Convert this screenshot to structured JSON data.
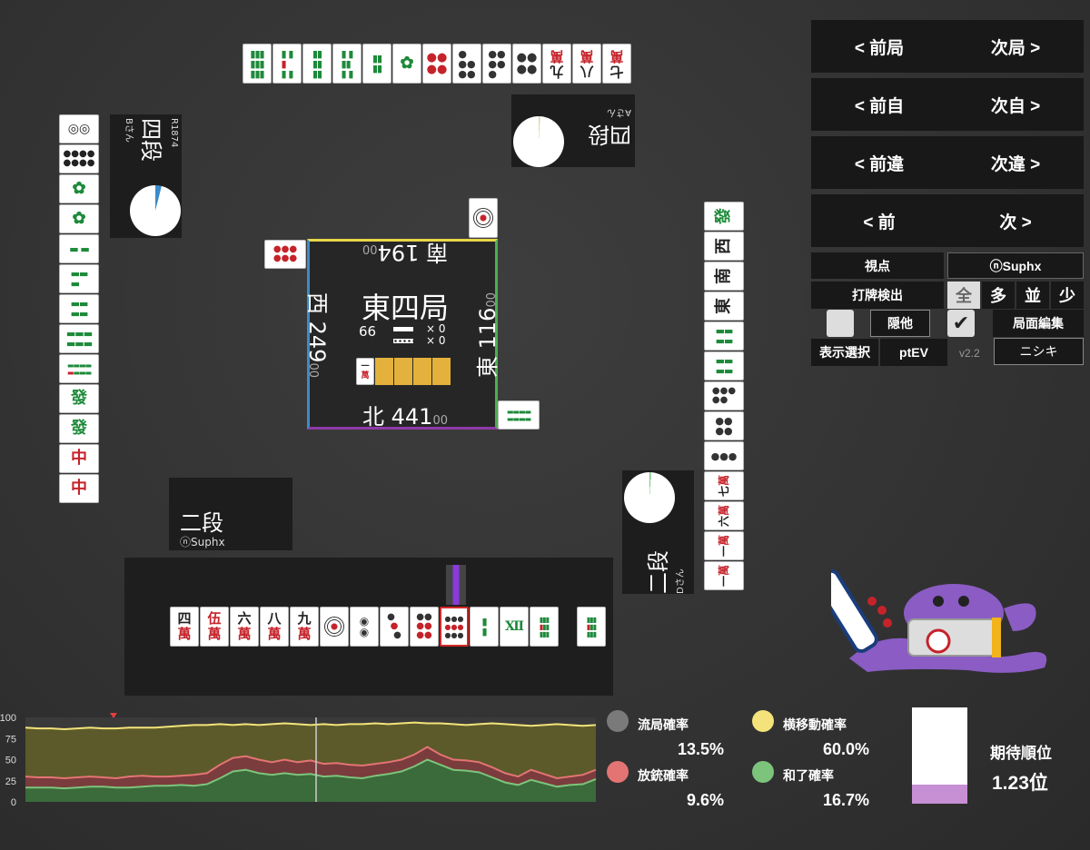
{
  "round": {
    "name": "東四局",
    "honba": "66",
    "riichi": "0",
    "honba_mult": "0"
  },
  "scores": {
    "south": {
      "wind": "南",
      "points": "194",
      "small": "00"
    },
    "west": {
      "wind": "西",
      "points": "249",
      "small": "00"
    },
    "east": {
      "wind": "東",
      "points": "116",
      "small": "00"
    },
    "north": {
      "wind": "北",
      "points": "441",
      "small": "00"
    }
  },
  "dora_indicator": {
    "top": "一",
    "bottom": "萬"
  },
  "players": {
    "top": {
      "rank": "四段",
      "name": "Aさん"
    },
    "left": {
      "rank": "四段",
      "name": "Bさん",
      "rate": "R1874"
    },
    "right": {
      "rank": "二段",
      "name": "Dさん"
    },
    "self": {
      "rank": "二段",
      "name": "ⓝSuphx"
    }
  },
  "hand": [
    {
      "t": "四",
      "b": "萬",
      "kind": "man"
    },
    {
      "t": "伍",
      "b": "萬",
      "kind": "man",
      "redtop": true
    },
    {
      "t": "六",
      "b": "萬",
      "kind": "man"
    },
    {
      "t": "八",
      "b": "萬",
      "kind": "man"
    },
    {
      "t": "九",
      "b": "萬",
      "kind": "man"
    },
    {
      "kind": "p1"
    },
    {
      "kind": "p2"
    },
    {
      "kind": "p3"
    },
    {
      "kind": "p6"
    },
    {
      "kind": "p9",
      "selected": true
    },
    {
      "kind": "s2"
    },
    {
      "kind": "s4"
    },
    {
      "kind": "s9"
    }
  ],
  "draw_tile": {
    "kind": "s9"
  },
  "nav": {
    "prev_round": "< 前局",
    "next_round": "次局 >",
    "prev_self": "< 前自",
    "next_self": "次自 >",
    "prev_diff": "< 前違",
    "next_diff": "次違 >",
    "prev": "< 前",
    "next": "次 >"
  },
  "controls": {
    "viewpoint_label": "視点",
    "viewpoint_value": "ⓝSuphx",
    "discard_detect_label": "打牌検出",
    "detect_opts": [
      "全",
      "多",
      "並",
      "少"
    ],
    "hide_others": "隠他",
    "board_edit": "局面編集",
    "display_select": "表示選択",
    "pt_ev": "ptEV",
    "version": "v2.2",
    "mascot_name": "ニシキ"
  },
  "stats": {
    "ryukyoku_label": "流局確率",
    "ryukyoku_value": "13.5%",
    "yokoido_label": "横移動確率",
    "yokoido_value": "60.0%",
    "houju_label": "放銃確率",
    "houju_value": "9.6%",
    "hora_label": "和了確率",
    "hora_value": "16.7%",
    "expected_rank_label": "期待順位",
    "expected_rank_value": "1.23位",
    "colors": {
      "ryukyoku": "#7a7a7a",
      "yokoido": "#f3e37a",
      "houju": "#e47474",
      "hora": "#7cc47c"
    }
  },
  "chart_data": {
    "type": "area",
    "ylim": [
      0,
      100
    ],
    "yticks": [
      "100",
      "75",
      "50",
      "25",
      "0"
    ],
    "series": [
      {
        "values": [
          88,
          87,
          87,
          86,
          87,
          88,
          87,
          87,
          88,
          88,
          88,
          89,
          90,
          91,
          91,
          92,
          91,
          92,
          91,
          92,
          93,
          92,
          91,
          92,
          91,
          92,
          92,
          93,
          92,
          93,
          94,
          93,
          93,
          92,
          91,
          92,
          93,
          92,
          91,
          90,
          91,
          92,
          91,
          90,
          91
        ]
      },
      {
        "values": [
          30,
          29,
          29,
          28,
          29,
          30,
          29,
          28,
          30,
          31,
          30,
          30,
          31,
          32,
          34,
          44,
          52,
          54,
          50,
          47,
          50,
          47,
          49,
          45,
          46,
          44,
          43,
          45,
          47,
          50,
          56,
          65,
          56,
          50,
          49,
          47,
          41,
          34,
          30,
          38,
          33,
          28,
          30,
          32,
          38
        ]
      },
      {
        "values": [
          17,
          17,
          17,
          16,
          17,
          18,
          18,
          17,
          17,
          18,
          19,
          19,
          20,
          19,
          21,
          28,
          36,
          38,
          34,
          32,
          34,
          32,
          33,
          30,
          31,
          29,
          28,
          31,
          33,
          36,
          42,
          50,
          44,
          38,
          37,
          35,
          29,
          23,
          20,
          26,
          22,
          18,
          20,
          21,
          27
        ]
      }
    ]
  }
}
